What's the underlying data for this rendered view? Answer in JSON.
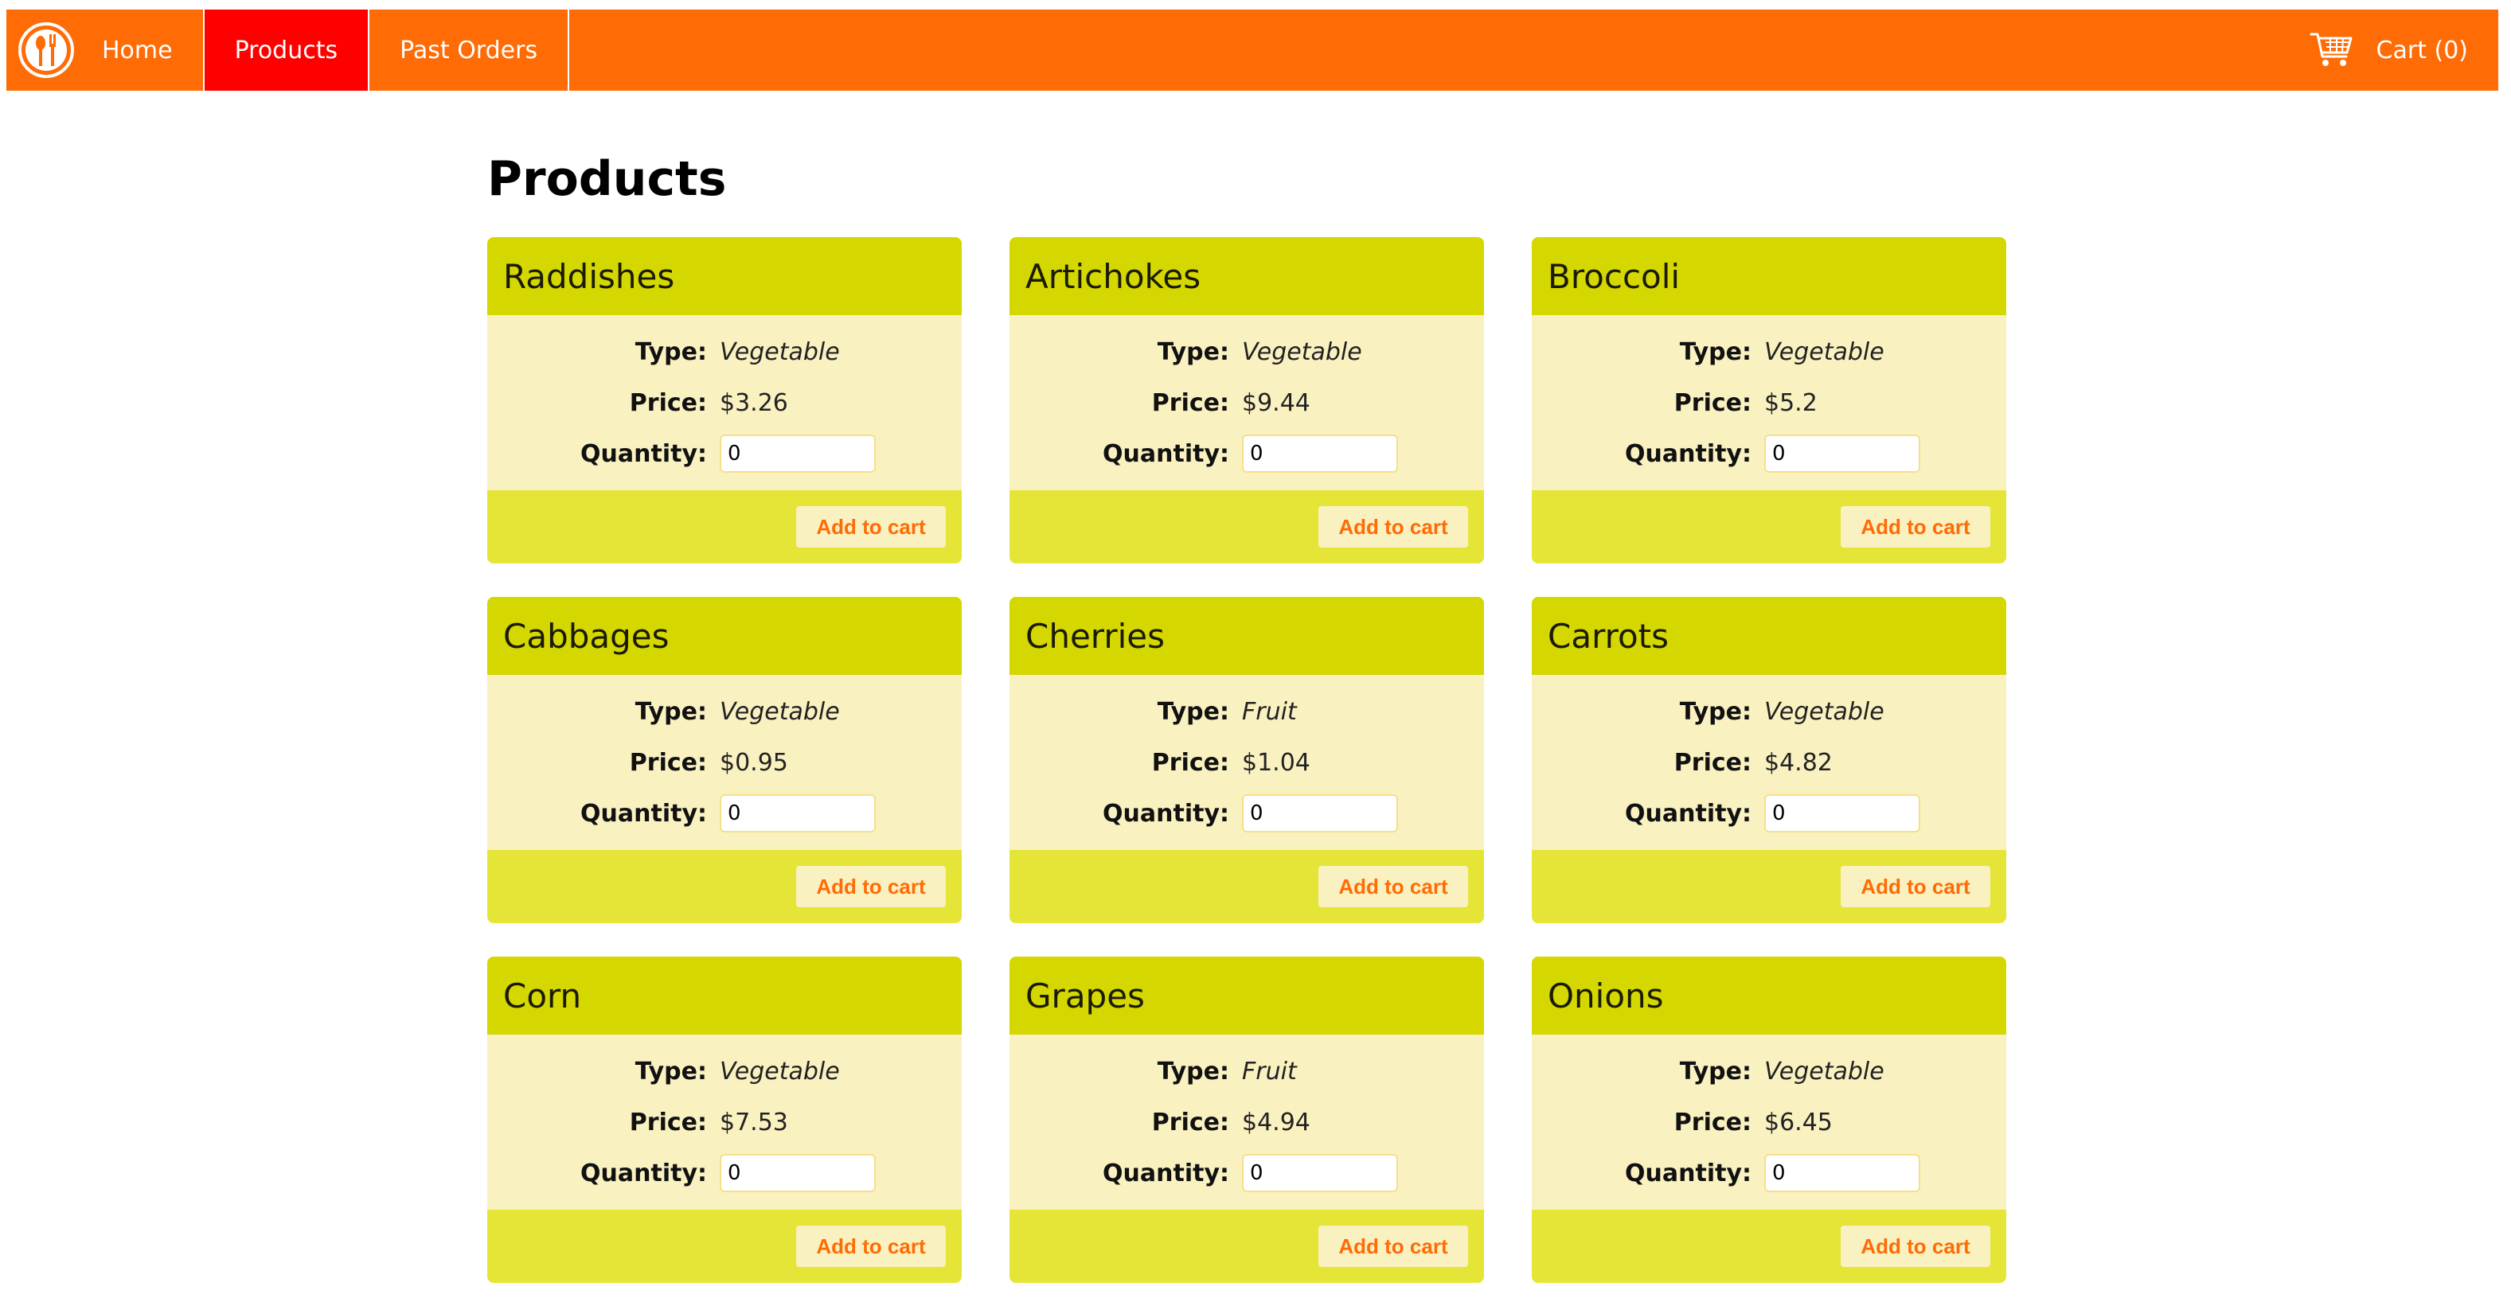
{
  "nav": {
    "home_label": "Home",
    "products_label": "Products",
    "past_orders_label": "Past Orders",
    "cart_label": "Cart (0)",
    "logo_icon": "utensils-logo-icon",
    "cart_icon": "shopping-cart-icon"
  },
  "page": {
    "title": "Products"
  },
  "labels": {
    "type": "Type:",
    "price": "Price:",
    "quantity": "Quantity:",
    "add_to_cart": "Add to cart"
  },
  "products": [
    {
      "name": "Raddishes",
      "type": "Vegetable",
      "price": "$3.26",
      "quantity": "0"
    },
    {
      "name": "Artichokes",
      "type": "Vegetable",
      "price": "$9.44",
      "quantity": "0"
    },
    {
      "name": "Broccoli",
      "type": "Vegetable",
      "price": "$5.2",
      "quantity": "0"
    },
    {
      "name": "Cabbages",
      "type": "Vegetable",
      "price": "$0.95",
      "quantity": "0"
    },
    {
      "name": "Cherries",
      "type": "Fruit",
      "price": "$1.04",
      "quantity": "0"
    },
    {
      "name": "Carrots",
      "type": "Vegetable",
      "price": "$4.82",
      "quantity": "0"
    },
    {
      "name": "Corn",
      "type": "Vegetable",
      "price": "$7.53",
      "quantity": "0"
    },
    {
      "name": "Grapes",
      "type": "Fruit",
      "price": "$4.94",
      "quantity": "0"
    },
    {
      "name": "Onions",
      "type": "Vegetable",
      "price": "$6.45",
      "quantity": "0"
    }
  ],
  "colors": {
    "nav_bg": "#FF6B05",
    "nav_active": "#FF0000",
    "card_header": "#D4D700",
    "card_body": "#FAF1C1",
    "card_footer": "#E5E538",
    "button_text": "#FF6B05"
  }
}
